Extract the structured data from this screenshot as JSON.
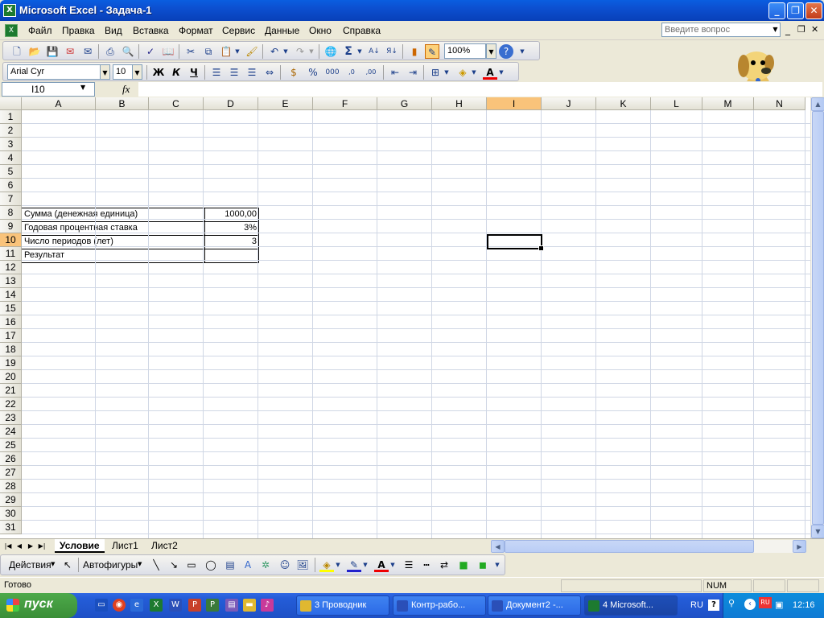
{
  "window": {
    "title": "Microsoft Excel - Задача-1"
  },
  "menu": [
    "Файл",
    "Правка",
    "Вид",
    "Вставка",
    "Формат",
    "Сервис",
    "Данные",
    "Окно",
    "Справка"
  ],
  "help_placeholder": "Введите вопрос",
  "toolbar_standard": {
    "zoom": "100%"
  },
  "toolbar_format": {
    "font": "Arial Cyr",
    "size": "10",
    "bold": "Ж",
    "italic": "К",
    "underline": "Ч"
  },
  "formula_bar": {
    "name_box": "I10",
    "fx": "fx",
    "formula": ""
  },
  "columns": [
    "A",
    "B",
    "C",
    "D",
    "E",
    "F",
    "G",
    "H",
    "I",
    "J",
    "K",
    "L",
    "M",
    "N"
  ],
  "rows": [
    "1",
    "2",
    "3",
    "4",
    "5",
    "6",
    "7",
    "8",
    "9",
    "10",
    "11",
    "12",
    "13",
    "14",
    "15",
    "16",
    "17",
    "18",
    "19",
    "20",
    "21",
    "22",
    "23",
    "24",
    "25",
    "26",
    "27",
    "28",
    "29",
    "30",
    "31"
  ],
  "cells": {
    "a1": "Сумма (денежная единица)",
    "d1": "1000,00",
    "a2": "Годовая процентная ставка",
    "d2": "3%",
    "a3": "Число периодов (лет)",
    "d3": "3",
    "a4": "Результат",
    "d4": ""
  },
  "sheet_tabs": [
    "Условие",
    "Лист1",
    "Лист2"
  ],
  "drawing_toolbar": {
    "actions": "Действия",
    "autoshapes": "Автофигуры"
  },
  "status": {
    "text": "Готово",
    "num": "NUM"
  },
  "taskbar": {
    "start": "пуск",
    "tasks": [
      "3 Проводник",
      "Контр-рабо...",
      "Документ2 -...",
      "4 Microsoft..."
    ],
    "lang": "RU",
    "clock": "12:16"
  },
  "colors": {
    "title": "#0a5ee0",
    "active_header": "#f9c37a",
    "taskbar": "#245dd8",
    "start": "#3a8e37"
  }
}
